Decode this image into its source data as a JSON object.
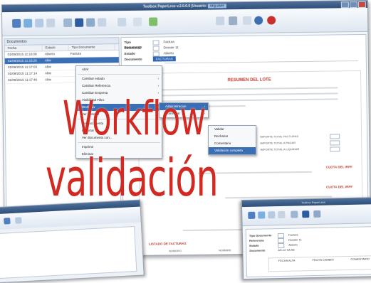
{
  "window": {
    "title": "Toolbox PaperLess v.2.0.0.0 (Usuario: ",
    "title_highlight": "org.user"
  },
  "documents_pane": {
    "header": "Documentos",
    "columns": [
      "Fecha",
      "Estado",
      "Tipo Documento"
    ],
    "rows": [
      {
        "fecha": "01/09/2015 11:16:08",
        "estado": "Abierto",
        "tipo": "Factura"
      },
      {
        "fecha": "01/09/2015 11:16:26",
        "estado": "Abie",
        "tipo": ""
      },
      {
        "fecha": "01/09/2015 11:17:03",
        "estado": "Abie",
        "tipo": ""
      },
      {
        "fecha": "01/09/2015 11:17:14",
        "estado": "Abie",
        "tipo": ""
      },
      {
        "fecha": "01/09/2015 11:17:46",
        "estado": "Abie",
        "tipo": ""
      }
    ]
  },
  "form": {
    "rows": [
      {
        "label": "Tipo Documento",
        "value": "Factura"
      },
      {
        "label": "Referencia",
        "value": "Dossier 11"
      },
      {
        "label": "Estado",
        "value": "Abierto"
      },
      {
        "label": "Documento",
        "value": "FACTURAS"
      }
    ]
  },
  "document": {
    "title": "RESUMEN DEL LOTE",
    "totals": [
      "IMPORTE TOTAL FACTURAS",
      "IMPORTE TOTAL A PAGAR",
      "IMPORTE TOTAL A LIQUIDAR"
    ],
    "side_labels": [
      "CUOTA DEL IRPF",
      "CUOTA DEL IRPF"
    ],
    "list_title": "LISTADO DE FACTURAS",
    "list_columns": [
      "NUMERO",
      "NOMBRE",
      "FECHA"
    ]
  },
  "context_menu": {
    "items": [
      {
        "label": "Abrir",
        "submenu": false
      },
      {
        "label": "Cambiar estado",
        "submenu": true
      },
      {
        "label": "Cambiar Referencia",
        "submenu": true
      },
      {
        "label": "Cambiar Empresa",
        "submenu": true
      },
      {
        "label": "Visibilidad Filtro",
        "submenu": true
      },
      {
        "label": "Workflow",
        "submenu": true,
        "highlighted": true
      },
      {
        "label": "Ver Historial",
        "submenu": false
      },
      {
        "label": "Ver documento",
        "submenu": false
      },
      {
        "label": "Exportar",
        "submenu": false
      },
      {
        "label": "Ver documento con...",
        "submenu": false
      },
      {
        "label": "Imprimir",
        "submenu": false
      },
      {
        "label": "Eliminar",
        "submenu": false
      }
    ]
  },
  "workflow_submenu": {
    "items": [
      {
        "label": "Administracion",
        "submenu": true
      },
      {
        "label": "Comercial",
        "submenu": true
      }
    ]
  },
  "action_submenu": {
    "items": [
      {
        "label": "Validar",
        "highlighted": false
      },
      {
        "label": "Rechazar",
        "highlighted": false
      },
      {
        "label": "Comentario",
        "highlighted": false
      },
      {
        "label": "Validación completa",
        "highlighted": true
      }
    ]
  },
  "overlay": {
    "line1": "Workflow",
    "line2": "validación"
  },
  "bottom_right_window": {
    "title": "Toolbox PaperLess",
    "form_rows": [
      {
        "label": "Tipo Documento",
        "value": "Factura"
      },
      {
        "label": "Referencia",
        "value": "Dossier 11"
      },
      {
        "label": "Estado",
        "value": "Abierto"
      },
      {
        "label": "Documento",
        "value": "AS-12 SA AE"
      }
    ],
    "grid_headers": [
      "FECHA ALTA",
      "FECHA CAMBIO",
      "COMENTARIO"
    ]
  },
  "colors": {
    "accent": "#3b6fb5",
    "overlay_text": "#d02a22",
    "title_bar": "#2f4f78"
  }
}
